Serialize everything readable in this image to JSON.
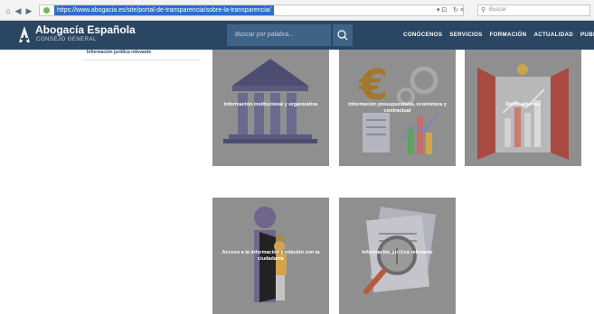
{
  "browser": {
    "url": "https://www.abogacia.es/site/portal-de-transparencia/sobre-la-transparencia/",
    "search_placeholder": "Buscar"
  },
  "header": {
    "brand_title": "Abogacía Española",
    "brand_subtitle": "CONSEJO GENERAL",
    "search_placeholder": "Buscar por palabra...",
    "nav": [
      "CONÓCENOS",
      "SERVICIOS",
      "FORMACIÓN",
      "ACTUALIDAD",
      "PUBLICACI"
    ]
  },
  "sidebar": {
    "items": [
      {
        "label": "Información jurídica relevante"
      }
    ]
  },
  "tiles": [
    {
      "label": "Información institucional y organizativa",
      "icon": "building-columns-icon"
    },
    {
      "label": "Información presupuestaria, económica y contractual",
      "icon": "euro-chart-icon"
    },
    {
      "label": "Datos abiertos",
      "icon": "open-window-chart-icon"
    },
    {
      "label": "Acceso a la información y relación con la ciudadanía",
      "icon": "person-door-icon"
    },
    {
      "label": "Información jurídica relevante",
      "icon": "magnifier-scales-icon"
    }
  ],
  "colors": {
    "header_bg": "#2a4663",
    "search_bg": "#3f6387",
    "tile_bg": "#8f8f8f",
    "url_highlight": "#2f6fc9"
  }
}
